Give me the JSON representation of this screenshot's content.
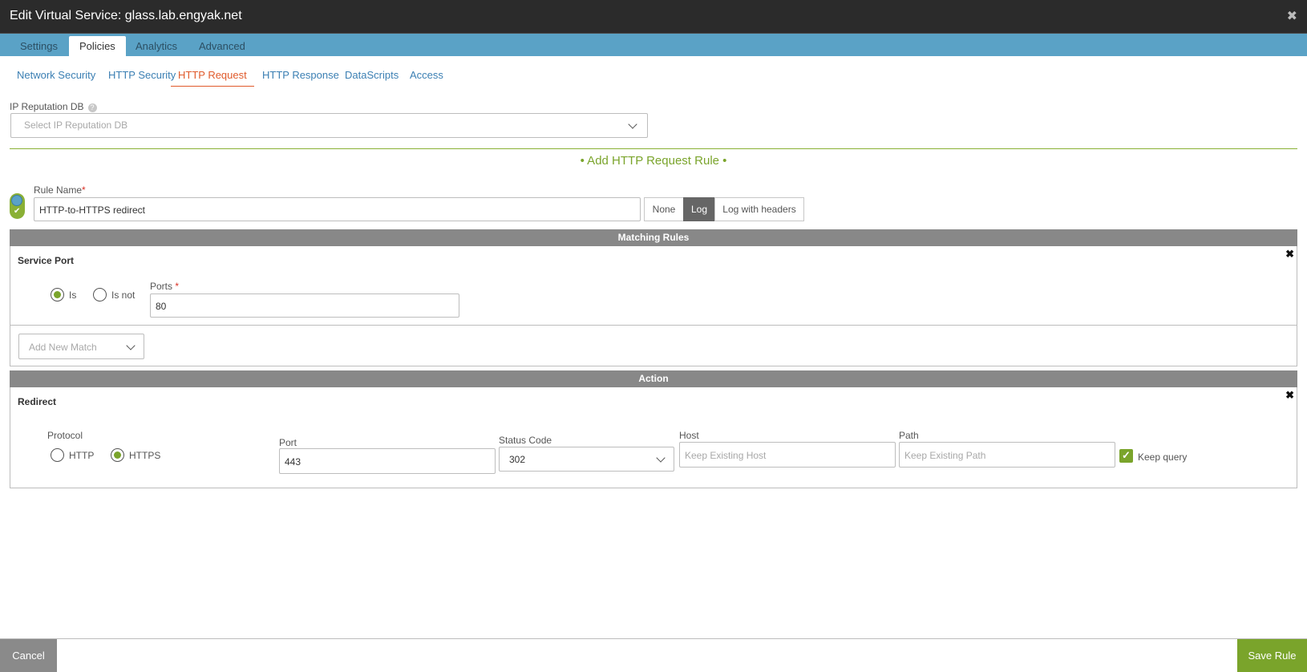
{
  "window": {
    "title": "Edit Virtual Service: glass.lab.engyak.net"
  },
  "tabs": [
    {
      "label": "Settings"
    },
    {
      "label": "Policies"
    },
    {
      "label": "Analytics"
    },
    {
      "label": "Advanced"
    }
  ],
  "subtabs": [
    {
      "label": "Network Security"
    },
    {
      "label": "HTTP Security"
    },
    {
      "label": "HTTP Request"
    },
    {
      "label": "HTTP Response"
    },
    {
      "label": "DataScripts"
    },
    {
      "label": "Access"
    }
  ],
  "ip_reputation": {
    "label": "IP Reputation DB",
    "placeholder": "Select IP Reputation DB"
  },
  "add_rule": {
    "label": "• Add HTTP Request Rule •"
  },
  "rule": {
    "name_label": "Rule Name",
    "required_mark": "*",
    "name_value": "HTTP-to-HTTPS redirect",
    "log_options": [
      "None",
      "Log",
      "Log with headers"
    ],
    "log_selected": "Log"
  },
  "matching": {
    "header": "Matching Rules",
    "service_port": {
      "title": "Service Port",
      "is_label": "Is",
      "is_not_label": "Is not",
      "selected": "Is",
      "ports_label": "Ports",
      "ports_value": "80"
    },
    "add_match_placeholder": "Add New Match"
  },
  "action": {
    "header": "Action",
    "redirect": {
      "title": "Redirect",
      "protocol_label": "Protocol",
      "http_label": "HTTP",
      "https_label": "HTTPS",
      "protocol_selected": "HTTPS",
      "port_label": "Port",
      "port_value": "443",
      "status_code_label": "Status Code",
      "status_code_value": "302",
      "host_label": "Host",
      "host_placeholder": "Keep Existing Host",
      "path_label": "Path",
      "path_placeholder": "Keep Existing Path",
      "keep_query_label": "Keep query",
      "keep_query_checked": true
    }
  },
  "footer": {
    "cancel_label": "Cancel",
    "save_label": "Save Rule"
  },
  "colors": {
    "titlebar": "#2b2b2b",
    "tabbar": "#5aa2c6",
    "accent_green": "#7aa42b",
    "active_subtab": "#e05a2b",
    "link_blue": "#3b7fb3"
  }
}
